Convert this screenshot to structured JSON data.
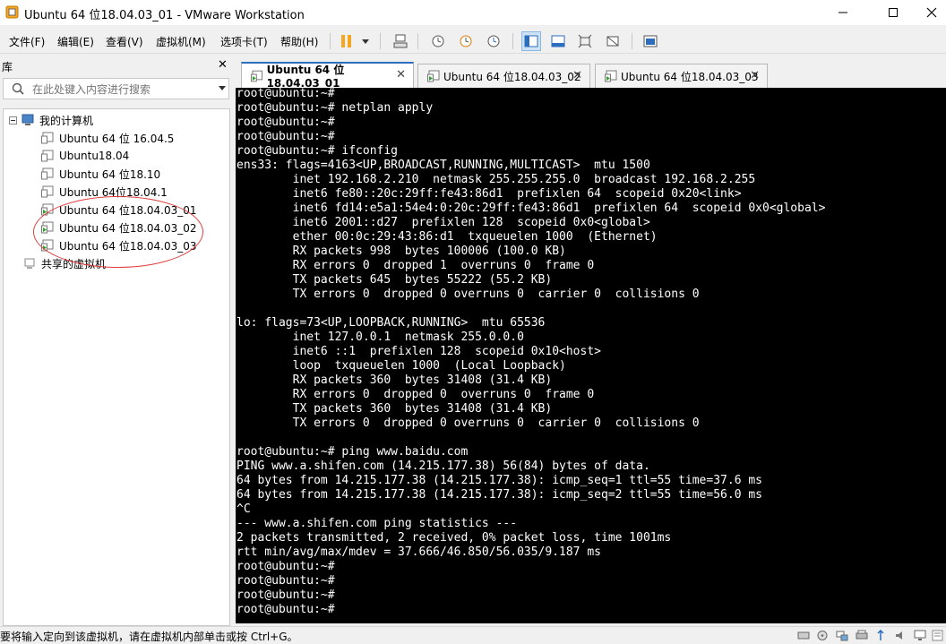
{
  "window": {
    "title": "Ubuntu 64 位18.04.03_01 - VMware Workstation"
  },
  "menu": [
    "文件(F)",
    "编辑(E)",
    "查看(V)",
    "虚拟机(M)",
    "选项卡(T)",
    "帮助(H)"
  ],
  "library": {
    "title": "库",
    "search_placeholder": "在此处键入内容进行搜索",
    "root": "我的计算机",
    "vms": [
      "Ubuntu 64 位 16.04.5",
      "Ubuntu18.04",
      "Ubuntu 64 位18.10",
      "Ubuntu 64位18.04.1",
      "Ubuntu 64 位18.04.03_01",
      "Ubuntu 64 位18.04.03_02",
      "Ubuntu 64 位18.04.03_03"
    ],
    "shared": "共享的虚拟机"
  },
  "tabs": [
    {
      "label": "Ubuntu 64 位18.04.03_01",
      "active": true
    },
    {
      "label": "Ubuntu 64 位18.04.03_02",
      "active": false
    },
    {
      "label": "Ubuntu 64 位18.04.03_03",
      "active": false
    }
  ],
  "terminal": {
    "lines": [
      "root@ubuntu:~#",
      "root@ubuntu:~# netplan apply",
      "root@ubuntu:~#",
      "root@ubuntu:~#",
      "root@ubuntu:~# ifconfig",
      "ens33: flags=4163<UP,BROADCAST,RUNNING,MULTICAST>  mtu 1500",
      "        inet 192.168.2.210  netmask 255.255.255.0  broadcast 192.168.2.255",
      "        inet6 fe80::20c:29ff:fe43:86d1  prefixlen 64  scopeid 0x20<link>",
      "        inet6 fd14:e5a1:54e4:0:20c:29ff:fe43:86d1  prefixlen 64  scopeid 0x0<global>",
      "        inet6 2001::d27  prefixlen 128  scopeid 0x0<global>",
      "        ether 00:0c:29:43:86:d1  txqueuelen 1000  (Ethernet)",
      "        RX packets 998  bytes 100006 (100.0 KB)",
      "        RX errors 0  dropped 1  overruns 0  frame 0",
      "        TX packets 645  bytes 55222 (55.2 KB)",
      "        TX errors 0  dropped 0 overruns 0  carrier 0  collisions 0",
      "",
      "lo: flags=73<UP,LOOPBACK,RUNNING>  mtu 65536",
      "        inet 127.0.0.1  netmask 255.0.0.0",
      "        inet6 ::1  prefixlen 128  scopeid 0x10<host>",
      "        loop  txqueuelen 1000  (Local Loopback)",
      "        RX packets 360  bytes 31408 (31.4 KB)",
      "        RX errors 0  dropped 0  overruns 0  frame 0",
      "        TX packets 360  bytes 31408 (31.4 KB)",
      "        TX errors 0  dropped 0 overruns 0  carrier 0  collisions 0",
      "",
      "root@ubuntu:~# ping www.baidu.com",
      "PING www.a.shifen.com (14.215.177.38) 56(84) bytes of data.",
      "64 bytes from 14.215.177.38 (14.215.177.38): icmp_seq=1 ttl=55 time=37.6 ms",
      "64 bytes from 14.215.177.38 (14.215.177.38): icmp_seq=2 ttl=55 time=56.0 ms",
      "^C",
      "--- www.a.shifen.com ping statistics ---",
      "2 packets transmitted, 2 received, 0% packet loss, time 1001ms",
      "rtt min/avg/max/mdev = 37.666/46.850/56.035/9.187 ms",
      "root@ubuntu:~#",
      "root@ubuntu:~#",
      "root@ubuntu:~#",
      "root@ubuntu:~#"
    ]
  },
  "status": {
    "text": "要将输入定向到该虚拟机，请在虚拟机内部单击或按 Ctrl+G。"
  },
  "colors": {
    "accent": "#2d6dbf",
    "annotation": "#e23b3b",
    "pause": "#f5a623"
  }
}
